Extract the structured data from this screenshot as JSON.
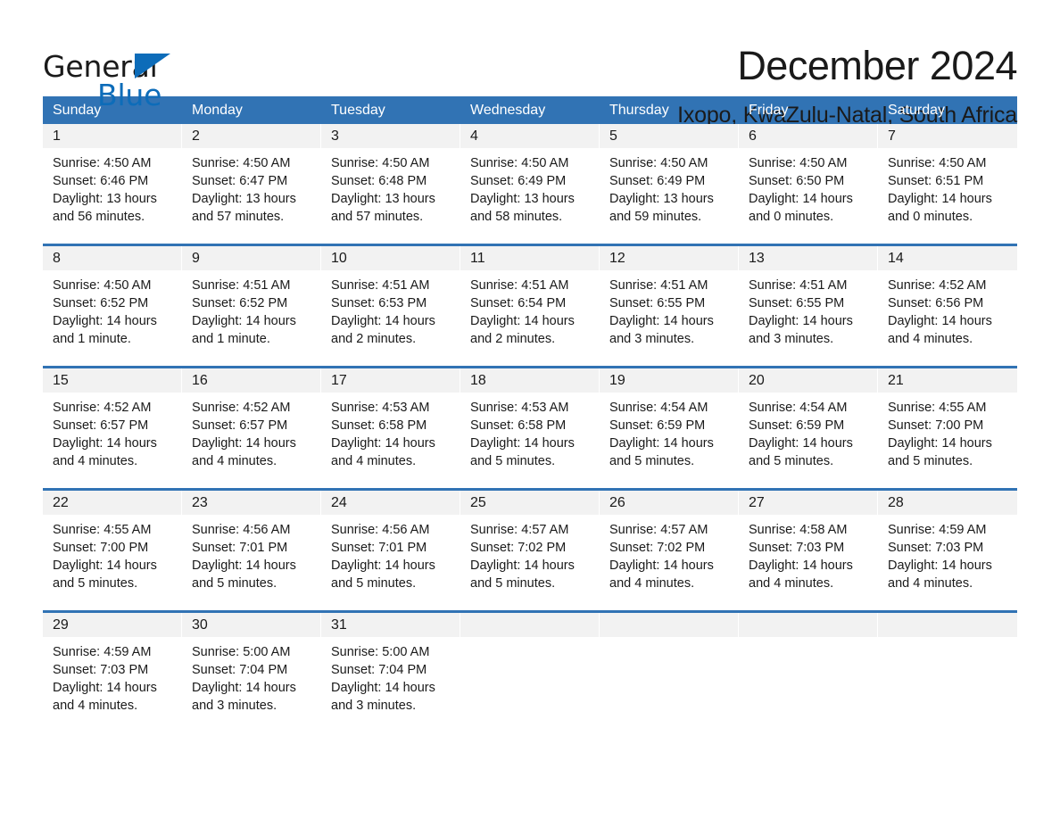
{
  "brand": {
    "name_part1": "General",
    "name_part2": "Blue",
    "triangle_color": "#0d6cb9"
  },
  "header": {
    "title": "December 2024",
    "location": "Ixopo, KwaZulu-Natal, South Africa"
  },
  "theme": {
    "header_blue": "#3173b4",
    "daynum_band_gray": "#f2f2f2",
    "text_color": "#1a1a1a"
  },
  "weekdays": [
    "Sunday",
    "Monday",
    "Tuesday",
    "Wednesday",
    "Thursday",
    "Friday",
    "Saturday"
  ],
  "weeks": [
    [
      {
        "day": "1",
        "sunrise": "Sunrise: 4:50 AM",
        "sunset": "Sunset: 6:46 PM",
        "daylight_line1": "Daylight: 13 hours",
        "daylight_line2": "and 56 minutes."
      },
      {
        "day": "2",
        "sunrise": "Sunrise: 4:50 AM",
        "sunset": "Sunset: 6:47 PM",
        "daylight_line1": "Daylight: 13 hours",
        "daylight_line2": "and 57 minutes."
      },
      {
        "day": "3",
        "sunrise": "Sunrise: 4:50 AM",
        "sunset": "Sunset: 6:48 PM",
        "daylight_line1": "Daylight: 13 hours",
        "daylight_line2": "and 57 minutes."
      },
      {
        "day": "4",
        "sunrise": "Sunrise: 4:50 AM",
        "sunset": "Sunset: 6:49 PM",
        "daylight_line1": "Daylight: 13 hours",
        "daylight_line2": "and 58 minutes."
      },
      {
        "day": "5",
        "sunrise": "Sunrise: 4:50 AM",
        "sunset": "Sunset: 6:49 PM",
        "daylight_line1": "Daylight: 13 hours",
        "daylight_line2": "and 59 minutes."
      },
      {
        "day": "6",
        "sunrise": "Sunrise: 4:50 AM",
        "sunset": "Sunset: 6:50 PM",
        "daylight_line1": "Daylight: 14 hours",
        "daylight_line2": "and 0 minutes."
      },
      {
        "day": "7",
        "sunrise": "Sunrise: 4:50 AM",
        "sunset": "Sunset: 6:51 PM",
        "daylight_line1": "Daylight: 14 hours",
        "daylight_line2": "and 0 minutes."
      }
    ],
    [
      {
        "day": "8",
        "sunrise": "Sunrise: 4:50 AM",
        "sunset": "Sunset: 6:52 PM",
        "daylight_line1": "Daylight: 14 hours",
        "daylight_line2": "and 1 minute."
      },
      {
        "day": "9",
        "sunrise": "Sunrise: 4:51 AM",
        "sunset": "Sunset: 6:52 PM",
        "daylight_line1": "Daylight: 14 hours",
        "daylight_line2": "and 1 minute."
      },
      {
        "day": "10",
        "sunrise": "Sunrise: 4:51 AM",
        "sunset": "Sunset: 6:53 PM",
        "daylight_line1": "Daylight: 14 hours",
        "daylight_line2": "and 2 minutes."
      },
      {
        "day": "11",
        "sunrise": "Sunrise: 4:51 AM",
        "sunset": "Sunset: 6:54 PM",
        "daylight_line1": "Daylight: 14 hours",
        "daylight_line2": "and 2 minutes."
      },
      {
        "day": "12",
        "sunrise": "Sunrise: 4:51 AM",
        "sunset": "Sunset: 6:55 PM",
        "daylight_line1": "Daylight: 14 hours",
        "daylight_line2": "and 3 minutes."
      },
      {
        "day": "13",
        "sunrise": "Sunrise: 4:51 AM",
        "sunset": "Sunset: 6:55 PM",
        "daylight_line1": "Daylight: 14 hours",
        "daylight_line2": "and 3 minutes."
      },
      {
        "day": "14",
        "sunrise": "Sunrise: 4:52 AM",
        "sunset": "Sunset: 6:56 PM",
        "daylight_line1": "Daylight: 14 hours",
        "daylight_line2": "and 4 minutes."
      }
    ],
    [
      {
        "day": "15",
        "sunrise": "Sunrise: 4:52 AM",
        "sunset": "Sunset: 6:57 PM",
        "daylight_line1": "Daylight: 14 hours",
        "daylight_line2": "and 4 minutes."
      },
      {
        "day": "16",
        "sunrise": "Sunrise: 4:52 AM",
        "sunset": "Sunset: 6:57 PM",
        "daylight_line1": "Daylight: 14 hours",
        "daylight_line2": "and 4 minutes."
      },
      {
        "day": "17",
        "sunrise": "Sunrise: 4:53 AM",
        "sunset": "Sunset: 6:58 PM",
        "daylight_line1": "Daylight: 14 hours",
        "daylight_line2": "and 4 minutes."
      },
      {
        "day": "18",
        "sunrise": "Sunrise: 4:53 AM",
        "sunset": "Sunset: 6:58 PM",
        "daylight_line1": "Daylight: 14 hours",
        "daylight_line2": "and 5 minutes."
      },
      {
        "day": "19",
        "sunrise": "Sunrise: 4:54 AM",
        "sunset": "Sunset: 6:59 PM",
        "daylight_line1": "Daylight: 14 hours",
        "daylight_line2": "and 5 minutes."
      },
      {
        "day": "20",
        "sunrise": "Sunrise: 4:54 AM",
        "sunset": "Sunset: 6:59 PM",
        "daylight_line1": "Daylight: 14 hours",
        "daylight_line2": "and 5 minutes."
      },
      {
        "day": "21",
        "sunrise": "Sunrise: 4:55 AM",
        "sunset": "Sunset: 7:00 PM",
        "daylight_line1": "Daylight: 14 hours",
        "daylight_line2": "and 5 minutes."
      }
    ],
    [
      {
        "day": "22",
        "sunrise": "Sunrise: 4:55 AM",
        "sunset": "Sunset: 7:00 PM",
        "daylight_line1": "Daylight: 14 hours",
        "daylight_line2": "and 5 minutes."
      },
      {
        "day": "23",
        "sunrise": "Sunrise: 4:56 AM",
        "sunset": "Sunset: 7:01 PM",
        "daylight_line1": "Daylight: 14 hours",
        "daylight_line2": "and 5 minutes."
      },
      {
        "day": "24",
        "sunrise": "Sunrise: 4:56 AM",
        "sunset": "Sunset: 7:01 PM",
        "daylight_line1": "Daylight: 14 hours",
        "daylight_line2": "and 5 minutes."
      },
      {
        "day": "25",
        "sunrise": "Sunrise: 4:57 AM",
        "sunset": "Sunset: 7:02 PM",
        "daylight_line1": "Daylight: 14 hours",
        "daylight_line2": "and 5 minutes."
      },
      {
        "day": "26",
        "sunrise": "Sunrise: 4:57 AM",
        "sunset": "Sunset: 7:02 PM",
        "daylight_line1": "Daylight: 14 hours",
        "daylight_line2": "and 4 minutes."
      },
      {
        "day": "27",
        "sunrise": "Sunrise: 4:58 AM",
        "sunset": "Sunset: 7:03 PM",
        "daylight_line1": "Daylight: 14 hours",
        "daylight_line2": "and 4 minutes."
      },
      {
        "day": "28",
        "sunrise": "Sunrise: 4:59 AM",
        "sunset": "Sunset: 7:03 PM",
        "daylight_line1": "Daylight: 14 hours",
        "daylight_line2": "and 4 minutes."
      }
    ],
    [
      {
        "day": "29",
        "sunrise": "Sunrise: 4:59 AM",
        "sunset": "Sunset: 7:03 PM",
        "daylight_line1": "Daylight: 14 hours",
        "daylight_line2": "and 4 minutes."
      },
      {
        "day": "30",
        "sunrise": "Sunrise: 5:00 AM",
        "sunset": "Sunset: 7:04 PM",
        "daylight_line1": "Daylight: 14 hours",
        "daylight_line2": "and 3 minutes."
      },
      {
        "day": "31",
        "sunrise": "Sunrise: 5:00 AM",
        "sunset": "Sunset: 7:04 PM",
        "daylight_line1": "Daylight: 14 hours",
        "daylight_line2": "and 3 minutes."
      },
      {
        "day": "",
        "sunrise": "",
        "sunset": "",
        "daylight_line1": "",
        "daylight_line2": ""
      },
      {
        "day": "",
        "sunrise": "",
        "sunset": "",
        "daylight_line1": "",
        "daylight_line2": ""
      },
      {
        "day": "",
        "sunrise": "",
        "sunset": "",
        "daylight_line1": "",
        "daylight_line2": ""
      },
      {
        "day": "",
        "sunrise": "",
        "sunset": "",
        "daylight_line1": "",
        "daylight_line2": ""
      }
    ]
  ]
}
